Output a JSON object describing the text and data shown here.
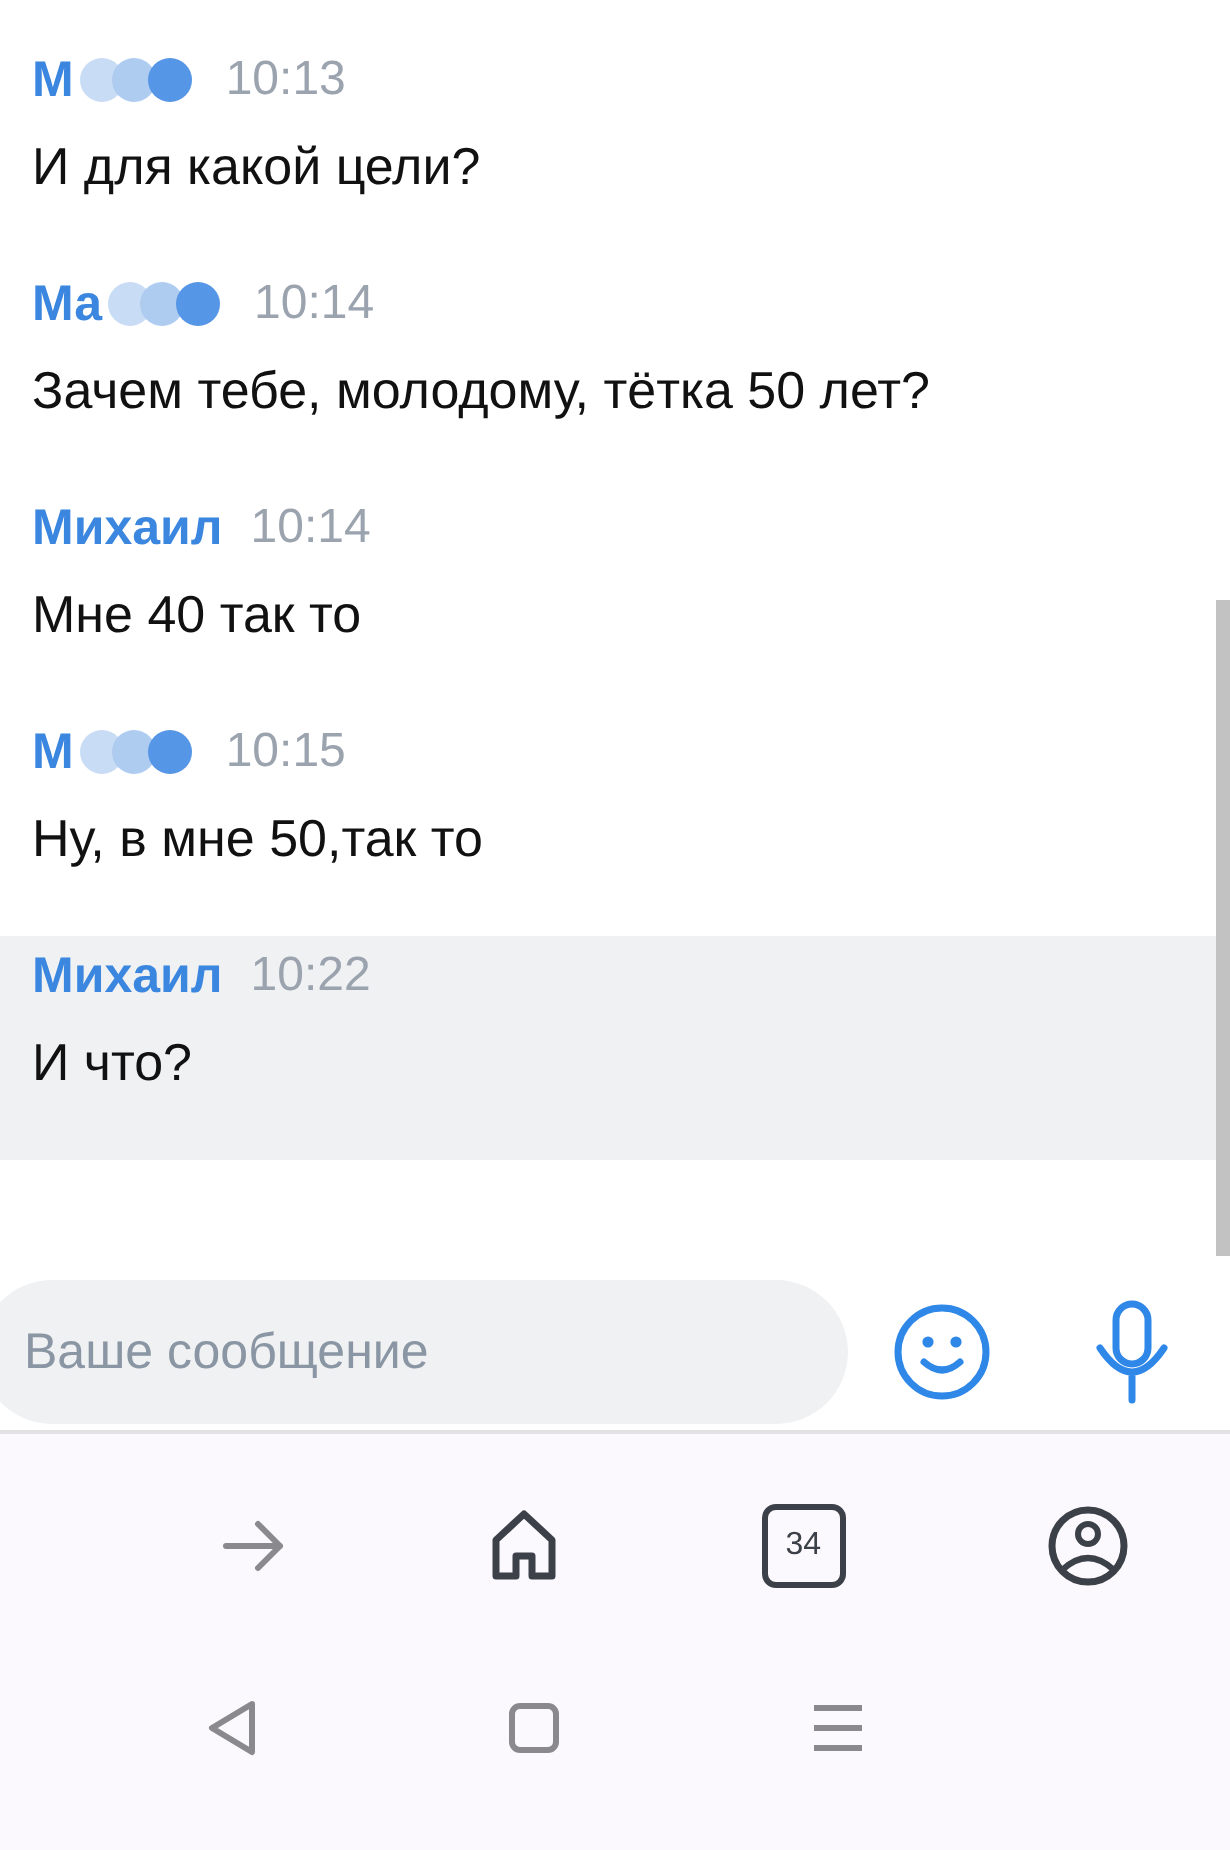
{
  "messages": [
    {
      "name": "М",
      "redacted": true,
      "time": "10:13",
      "text": "И для какой цели?",
      "highlighted": false
    },
    {
      "name": "Ма",
      "redacted": true,
      "time": "10:14",
      "text": "Зачем тебе, молодому, тётка 50 лет?",
      "highlighted": false
    },
    {
      "name": "Михаил",
      "redacted": false,
      "time": "10:14",
      "text": "Мне 40 так то",
      "highlighted": false
    },
    {
      "name": "М",
      "redacted": true,
      "time": "10:15",
      "text": "Ну, в мне 50,так то",
      "highlighted": false
    },
    {
      "name": "Михаил",
      "redacted": false,
      "time": "10:22",
      "text": "И что?",
      "highlighted": true
    }
  ],
  "composer": {
    "placeholder": "Ваше сообщение"
  },
  "browser_bar": {
    "tab_count": "34"
  }
}
